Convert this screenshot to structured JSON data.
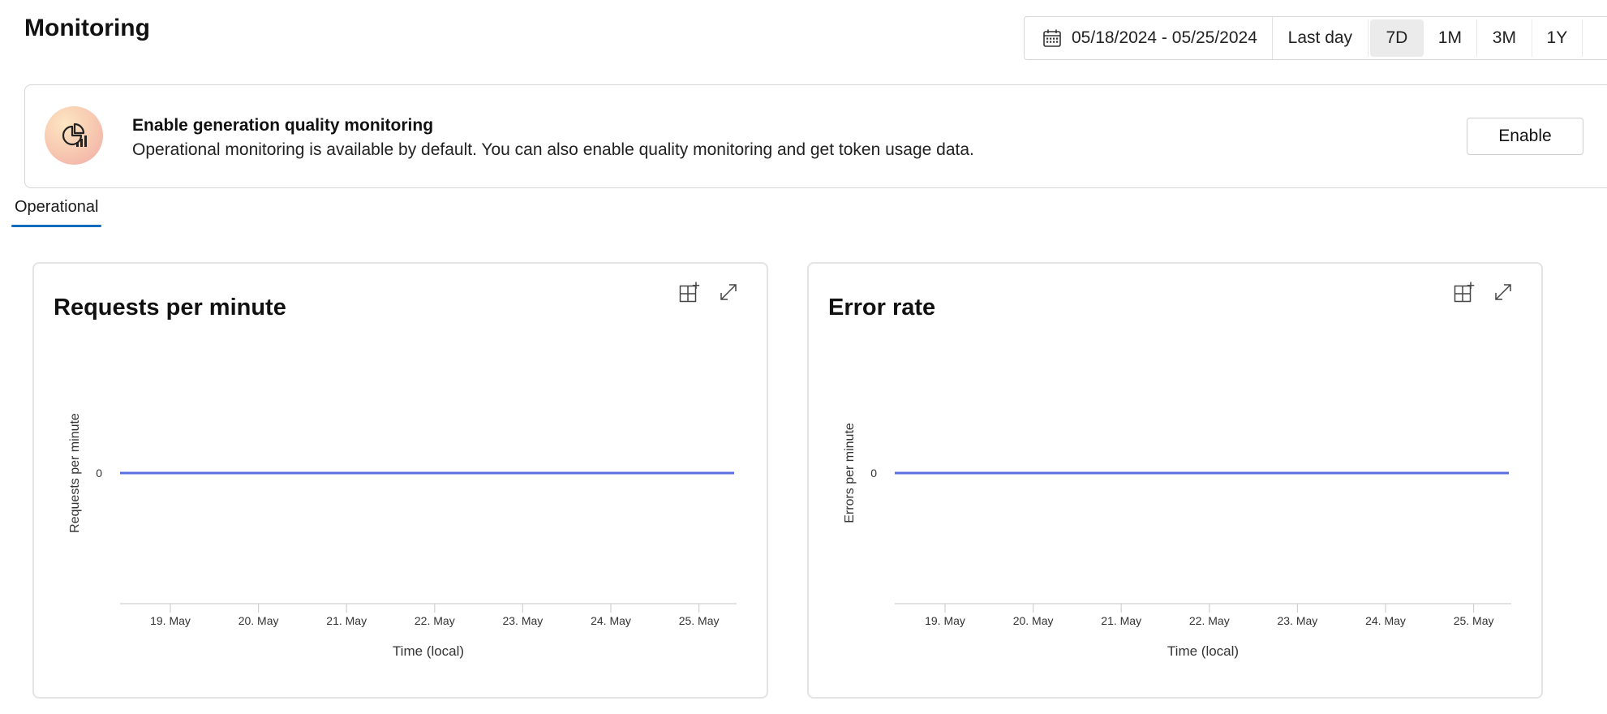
{
  "header": {
    "title": "Monitoring"
  },
  "time_range": {
    "date_range": "05/18/2024 - 05/25/2024",
    "options": [
      "Last day",
      "7D",
      "1M",
      "3M",
      "1Y"
    ],
    "selected": "7D"
  },
  "banner": {
    "title": "Enable generation quality monitoring",
    "description": "Operational monitoring is available by default. You can also enable quality monitoring and get token usage data.",
    "enable_label": "Enable",
    "icon": "pie-chart-bars-icon"
  },
  "tabs": [
    {
      "label": "Operational",
      "active": true
    }
  ],
  "colors": {
    "accent": "#0f6cbd",
    "series": "#5b6fe0"
  },
  "chart_data": [
    {
      "type": "line",
      "title": "Requests per minute",
      "xlabel": "Time (local)",
      "ylabel": "Requests per minute",
      "categories": [
        "19. May",
        "20. May",
        "21. May",
        "22. May",
        "23. May",
        "24. May",
        "25. May"
      ],
      "yticks": [
        "0"
      ],
      "series": [
        {
          "values": [
            0,
            0,
            0,
            0,
            0,
            0,
            0
          ]
        }
      ]
    },
    {
      "type": "line",
      "title": "Error rate",
      "xlabel": "Time (local)",
      "ylabel": "Errors per minute",
      "categories": [
        "19. May",
        "20. May",
        "21. May",
        "22. May",
        "23. May",
        "24. May",
        "25. May"
      ],
      "yticks": [
        "0"
      ],
      "series": [
        {
          "values": [
            0,
            0,
            0,
            0,
            0,
            0,
            0
          ]
        }
      ]
    }
  ]
}
